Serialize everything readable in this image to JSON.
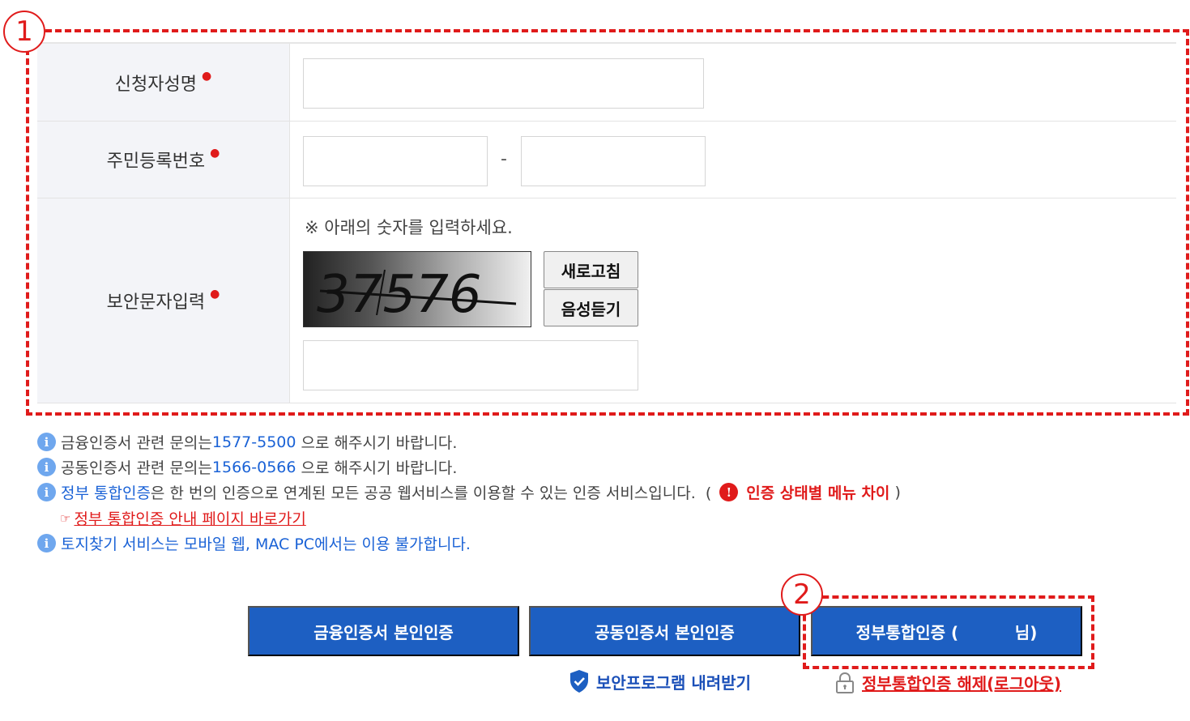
{
  "annotations": {
    "badge1": "1",
    "badge2": "2"
  },
  "form": {
    "name_label": "신청자성명",
    "rrn_label": "주민등록번호",
    "rrn_separator": "-",
    "captcha_label": "보안문자입력",
    "required_mark": "●",
    "captcha_guide": "※ 아래의 숫자를 입력하세요.",
    "captcha_code": "37576",
    "refresh_button": "새로고침",
    "audio_button": "음성듣기",
    "name_value": "",
    "rrn_front_value": "",
    "rrn_back_value": "",
    "captcha_value": ""
  },
  "notes": {
    "note1_pre": "금융인증서 관련 문의는",
    "note1_phone": "1577-5500",
    "note1_post": " 으로 해주시기 바랍니다.",
    "note2_pre": "공동인증서 관련 문의는",
    "note2_phone": "1566-0566",
    "note2_post": " 으로 해주시기 바랍니다.",
    "note3_term": "정부 통합인증",
    "note3_text": "은 한 번의 인증으로 연계된 모든 공공 웹서비스를 이용할 수 있는 인증 서비스입니다.  (",
    "note3_link": "인증 상태별 메뉴 차이",
    "note3_close": " )",
    "guide_link_icon": "☞",
    "guide_link": "정부 통합인증 안내 페이지 바로가기",
    "note4": "토지찾기 서비스는 모바일 웹, MAC PC에서는 이용 불가합니다.",
    "info_icon_glyph": "i"
  },
  "buttons": {
    "financial_cert": "금융인증서 본인인증",
    "joint_cert": "공동인증서 본인인증",
    "gov_cert": "정부통합인증 (          님)",
    "security_download": "보안프로그램 내려받기",
    "logout": "정부통합인증 해제(로그아웃)"
  },
  "icons": {
    "info": "info-circle-icon",
    "warning": "exclamation-circle-icon",
    "shield": "shield-check-icon",
    "lock": "lock-icon",
    "pointing_hand": "pointing-hand-icon"
  },
  "colors": {
    "accent_blue": "#1d5fc2",
    "link_blue": "#1a62d6",
    "alert_red": "#e01b1b",
    "header_bg": "#f3f4f8"
  }
}
